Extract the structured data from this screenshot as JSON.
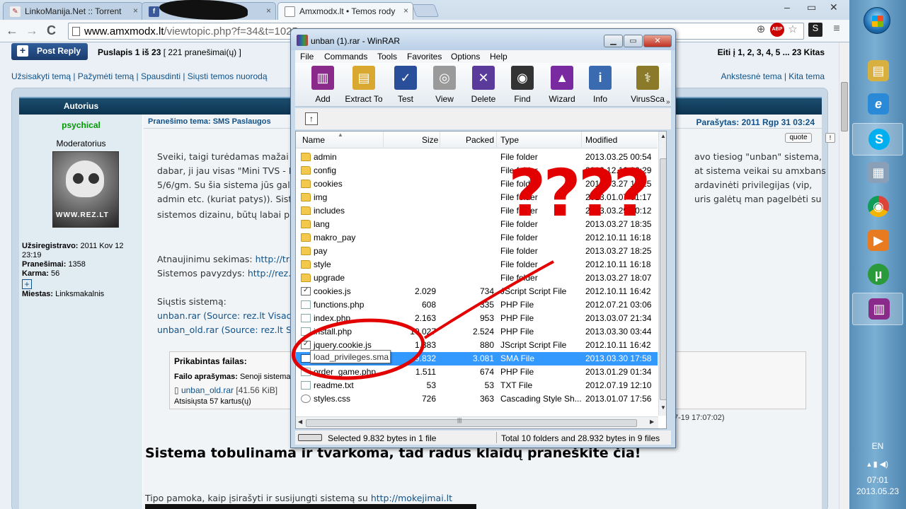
{
  "browser": {
    "tabs": [
      {
        "label": "LinkoManija.Net :: Torrent",
        "favicon": "linkomanija-icon",
        "close": "×"
      },
      {
        "label": "",
        "favicon": "facebook-icon",
        "favicon_text": "f",
        "close": "×"
      },
      {
        "label": "Amxmodx.lt • Temos rody",
        "favicon": "page-icon",
        "close": "×"
      }
    ],
    "url_host": "www.amxmodx.lt",
    "url_path": "/viewtopic.php?f=34&t=1025",
    "nav": {
      "back": "←",
      "forward": "→",
      "reload": "C"
    },
    "toolbar_icons": [
      "zoom-icon",
      "adblock-icon",
      "star-icon",
      "extension-icon",
      "menu-icon"
    ],
    "adblock_text": "ABP",
    "window_controls": {
      "minimize": "–",
      "maximize": "▭",
      "close": "✕"
    }
  },
  "forum": {
    "post_reply_label": "Post Reply",
    "pagination": "Puslapis 1 iš 23",
    "pagination_count": "[ 221 pranešimai(ų) ]",
    "goto_pages": "Eiti į 1, 2, 3, 4, 5 ... 23  Kitas",
    "thread_tools": "Užsisakyti temą | Pažymėti temą | Spausdinti | Siųsti temos nuorodą",
    "prev_next": "Ankstesnė tema | Kita tema",
    "author_header": "Autorius",
    "author": {
      "name": "psychical",
      "rank": "Moderatorius",
      "avatar_text": "WWW.REZ.LT",
      "registered_label": "Užsiregistravo:",
      "registered_value": "2011 Kov 12 23:19",
      "posts_label": "Pranešimai:",
      "posts_value": "1358",
      "karma_label": "Karma:",
      "karma_value": "56",
      "plus": "+",
      "city_label": "Miestas:",
      "city_value": "Linksmakalnis"
    },
    "post": {
      "title": "Pranešimo tema: SMS Paslaugos",
      "date": "Parašytas: 2011 Rgp 31 03:24",
      "quote_label": "quote",
      "report_label": "!",
      "lines": [
        "Sveiki, taigi turėdamas mažai lais",
        "dabar, ji jau visas \"Mini TVS - Fo",
        "5/6/gm. Su šia sistema jūs galite",
        "admin etc. (kuriat patys)). Sister",
        "sistemos dizainu, būtų labai puik"
      ],
      "right_lines": [
        "avo tiesiog \"unban\" sistema,",
        "at sistema veikai su amxbans",
        "ardavinėti privilegijas (vip,",
        "uris galėtų man pagelbėti su"
      ],
      "updates_label": "Atnaujinimu sekimas:",
      "updates_link": "http://tra",
      "example_label": "Sistemos pavyzdys:",
      "example_link": "http://rez.lt",
      "download_label": "Siųstis sistemą:",
      "download_1": "unban.rar (Source: rez.lt Visada",
      "download_2": "unban_old.rar (Source: rez.lt Ser",
      "attachment": {
        "title": "Prikabintas failas:",
        "desc_label": "Failo aprašymas:",
        "desc_value": "Senoji sistema, je",
        "file": "unban_old.rar",
        "size": "[41.56 KiB]",
        "downloads": "Atsisiųsta 57 kartus(ų)",
        "time_fragment": "7-19 17:07:02)"
      },
      "big_heading": "Sistema tobulinama ir tvarkoma, tad radus klaidų praneškite čia!",
      "tutorial_text": "Tipo pamoka, kaip įsirašyti ir susijungti sistemą su",
      "tutorial_link": "http://mokejimai.lt"
    }
  },
  "winrar": {
    "title": "unban (1).rar - WinRAR",
    "caption_buttons": {
      "minimize": "▁",
      "maximize": "▭",
      "close": "✕"
    },
    "menu": [
      "File",
      "Commands",
      "Tools",
      "Favorites",
      "Options",
      "Help"
    ],
    "tools": [
      {
        "label": "Add",
        "icon": "add-archive-icon",
        "color": "#8a2a8a"
      },
      {
        "label": "Extract To",
        "icon": "extract-folder-icon",
        "color": "#d8a830"
      },
      {
        "label": "Test",
        "icon": "test-archive-icon",
        "color": "#2a4f9a"
      },
      {
        "label": "View",
        "icon": "view-glasses-icon",
        "color": "#7a7a7a"
      },
      {
        "label": "Delete",
        "icon": "delete-books-icon",
        "color": "#5a3a9a"
      },
      {
        "label": "Find",
        "icon": "find-binoculars-icon",
        "color": "#333333"
      },
      {
        "label": "Wizard",
        "icon": "wizard-hat-icon",
        "color": "#7a2aa0"
      },
      {
        "label": "Info",
        "icon": "info-icon",
        "color": "#3a6ab0"
      },
      {
        "label": "VirusSca",
        "icon": "virus-scan-icon",
        "color": "#8a7a2a"
      }
    ],
    "more_arrow": "»",
    "up_label": "↑",
    "columns": {
      "name": "Name",
      "size": "Size",
      "packed": "Packed",
      "type": "Type",
      "modified": "Modified"
    },
    "files": [
      {
        "name": "admin",
        "size": "",
        "packed": "",
        "type": "File folder",
        "modified": "2013.03.25 00:54",
        "icon": "folder"
      },
      {
        "name": "config",
        "size": "",
        "packed": "",
        "type": "File folder",
        "modified": "2012.12.12 00:29",
        "icon": "folder"
      },
      {
        "name": "cookies",
        "size": "",
        "packed": "",
        "type": "File folder",
        "modified": "2013.03.27 18:25",
        "icon": "folder"
      },
      {
        "name": "img",
        "size": "",
        "packed": "",
        "type": "File folder",
        "modified": "2013.01.07 01:17",
        "icon": "folder"
      },
      {
        "name": "includes",
        "size": "",
        "packed": "",
        "type": "File folder",
        "modified": "2013.03.29 20:12",
        "icon": "folder"
      },
      {
        "name": "lang",
        "size": "",
        "packed": "",
        "type": "File folder",
        "modified": "2013.03.27 18:35",
        "icon": "folder"
      },
      {
        "name": "makro_pay",
        "size": "",
        "packed": "",
        "type": "File folder",
        "modified": "2012.10.11 16:18",
        "icon": "folder"
      },
      {
        "name": "pay",
        "size": "",
        "packed": "",
        "type": "File folder",
        "modified": "2013.03.27 18:25",
        "icon": "folder"
      },
      {
        "name": "style",
        "size": "",
        "packed": "",
        "type": "File folder",
        "modified": "2012.10.11 16:18",
        "icon": "folder"
      },
      {
        "name": "upgrade",
        "size": "",
        "packed": "",
        "type": "File folder",
        "modified": "2013.03.27 18:07",
        "icon": "folder"
      },
      {
        "name": "cookies.js",
        "size": "2.029",
        "packed": "734",
        "type": "JScript Script File",
        "modified": "2012.10.11 16:42",
        "icon": "js"
      },
      {
        "name": "functions.php",
        "size": "608",
        "packed": "335",
        "type": "PHP File",
        "modified": "2012.07.21 03:06",
        "icon": "file"
      },
      {
        "name": "index.php",
        "size": "2.163",
        "packed": "953",
        "type": "PHP File",
        "modified": "2013.03.07 21:34",
        "icon": "file"
      },
      {
        "name": "install.php",
        "size": "10.027",
        "packed": "2.524",
        "type": "PHP File",
        "modified": "2013.03.30 03:44",
        "icon": "file"
      },
      {
        "name": "jquery.cookie.js",
        "size": "1.883",
        "packed": "880",
        "type": "JScript Script File",
        "modified": "2012.10.11 16:42",
        "icon": "js"
      },
      {
        "name": "load_privileges.sma",
        "size": "9.832",
        "packed": "3.081",
        "type": "SMA File",
        "modified": "2013.03.30 17:58",
        "icon": "sma",
        "selected": true
      },
      {
        "name": "order_game.php",
        "size": "1.511",
        "packed": "674",
        "type": "PHP File",
        "modified": "2013.01.29 01:34",
        "icon": "file"
      },
      {
        "name": "readme.txt",
        "size": "53",
        "packed": "53",
        "type": "TXT File",
        "modified": "2012.07.19 12:10",
        "icon": "file"
      },
      {
        "name": "styles.css",
        "size": "726",
        "packed": "363",
        "type": "Cascading Style Sh...",
        "modified": "2013.01.07 17:56",
        "icon": "gear"
      }
    ],
    "tooltip": "load_privileges.sma",
    "status_left": "Selected 9.832 bytes in 1 file",
    "status_right": "Total 10 folders and 28.932 bytes in 9 files"
  },
  "annotation": {
    "question_marks": "????",
    "color": "#e20000"
  },
  "taskbar": {
    "apps": [
      {
        "icon": "file-explorer-icon",
        "color": "#d8b040",
        "glyph": "▤"
      },
      {
        "icon": "internet-explorer-icon",
        "color": "#2a8ad8",
        "glyph": "e"
      },
      {
        "icon": "skype-icon",
        "color": "#00aff0",
        "glyph": "S",
        "active": true
      },
      {
        "icon": "calculator-icon",
        "color": "#8aa0b8",
        "glyph": "▦"
      },
      {
        "icon": "chrome-icon",
        "color": "#d84a38",
        "glyph": "◉"
      },
      {
        "icon": "media-player-icon",
        "color": "#e87a20",
        "glyph": "▶"
      },
      {
        "icon": "utorrent-icon",
        "color": "#2a9a3a",
        "glyph": "µ"
      },
      {
        "icon": "winrar-icon",
        "color": "#8a2a8a",
        "glyph": "▥",
        "active": true
      }
    ],
    "language": "EN",
    "tray_icons": "▴  ▮ ◀)",
    "time": "07:01",
    "date": "2013.05.23"
  },
  "accent_color": "#105289"
}
